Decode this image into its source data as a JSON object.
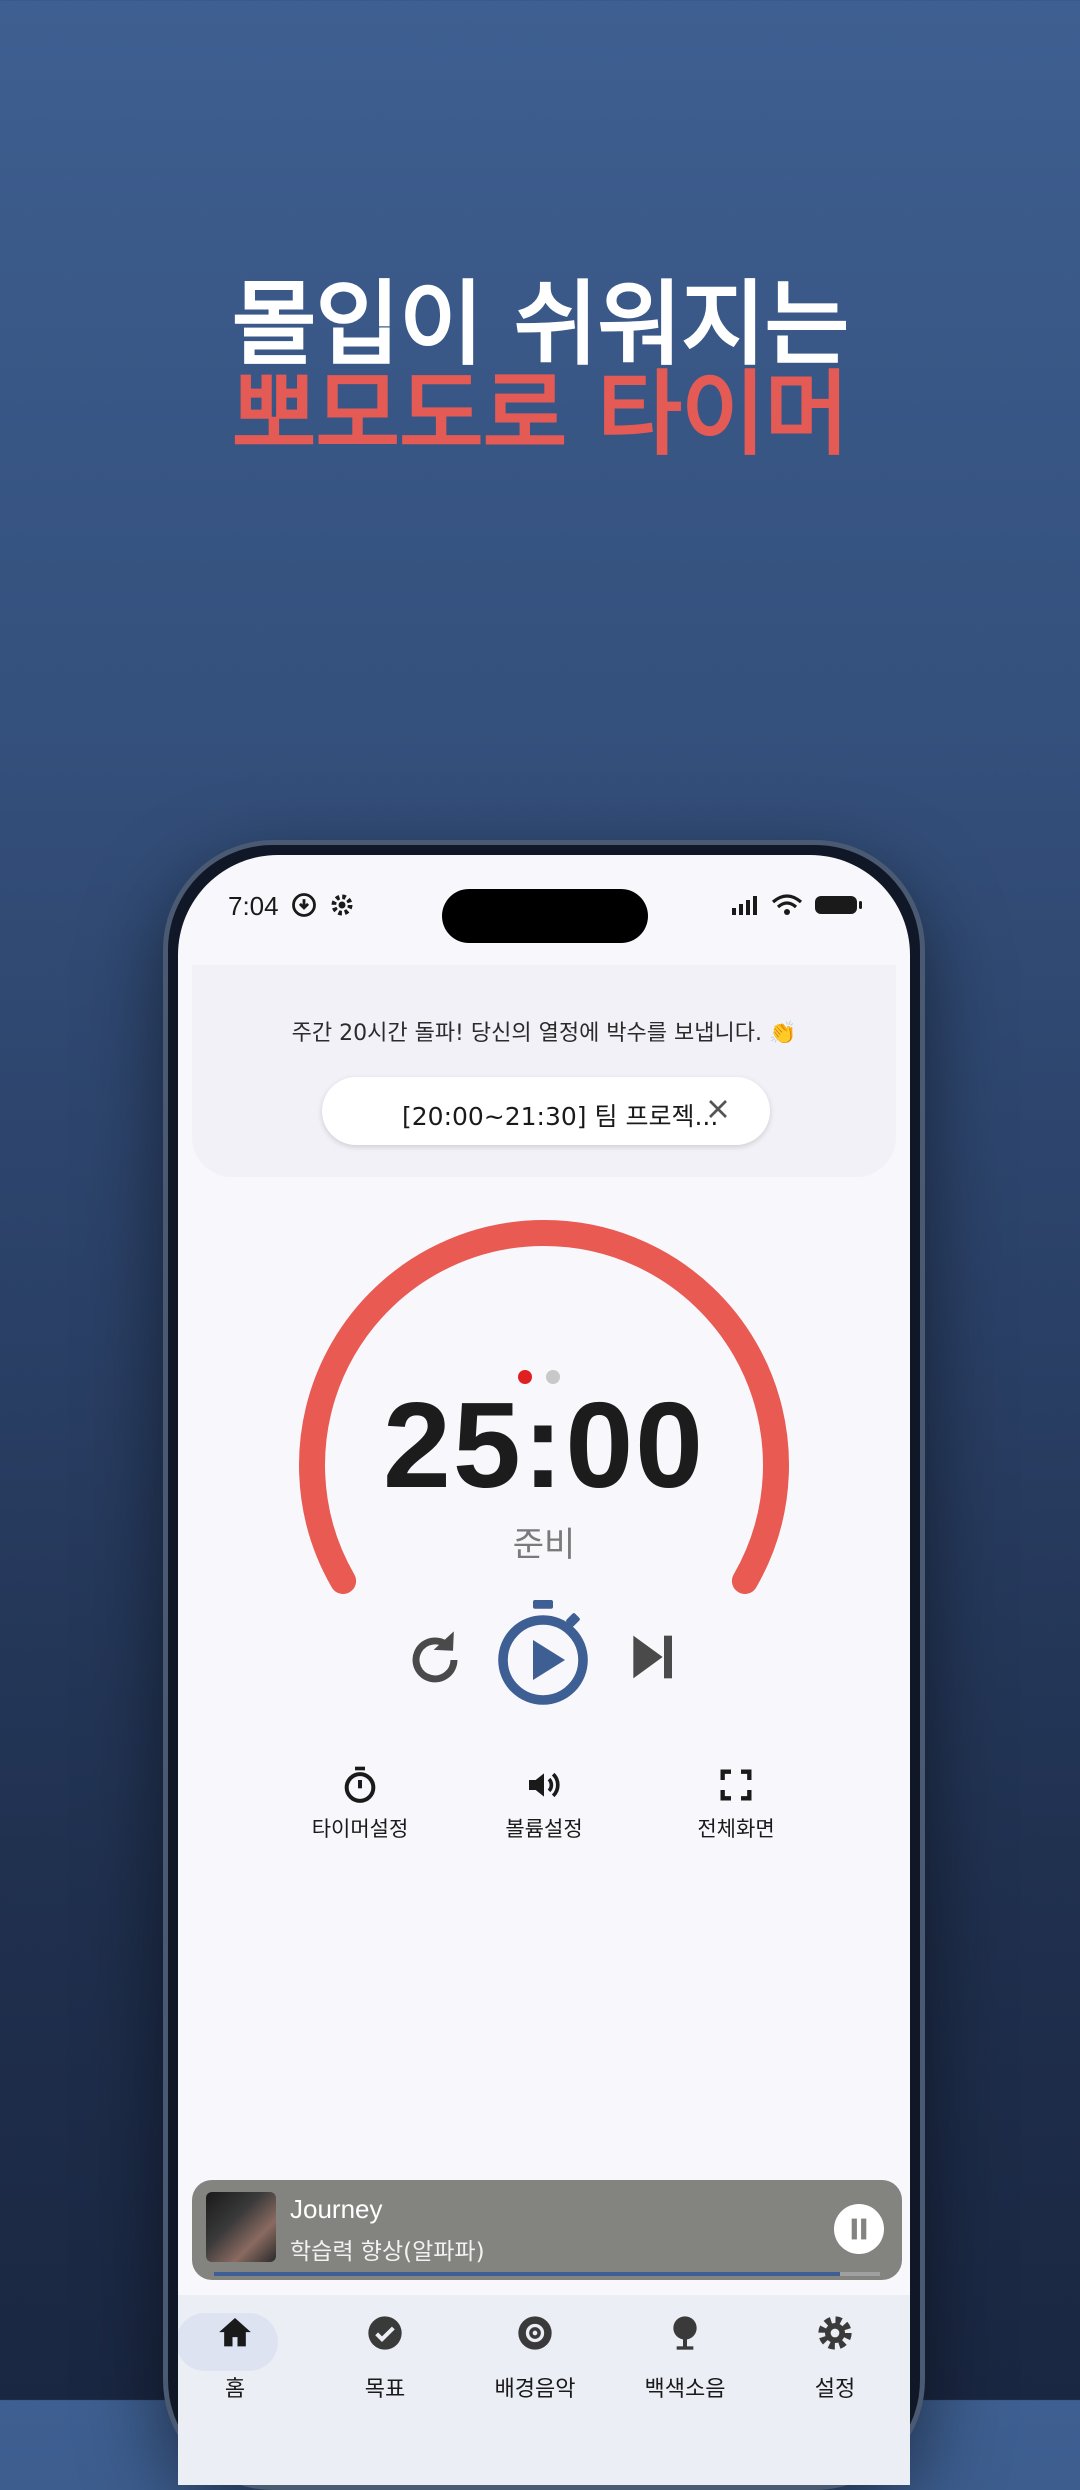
{
  "headline": {
    "line1": "몰입이 쉬워지는",
    "line2": "뽀모도로 타이머"
  },
  "status_bar": {
    "time": "7:04"
  },
  "banner": {
    "message": "주간 20시간 돌파! 당신의 열정에 박수를 보냅니다. 👏",
    "task": "[20:00~21:30] 팀 프로젝..."
  },
  "timer": {
    "time": "25:00",
    "state": "준비",
    "progress_ratio": 1.0,
    "page_dots": 2,
    "active_dot": 0
  },
  "colors": {
    "accent": "#e85a52",
    "brand_blue": "#3d5f94",
    "dot_inactive": "#c8c8c8"
  },
  "controls": {
    "reset_icon": "reset-icon",
    "play_icon": "play-timer-icon",
    "skip_icon": "skip-next-icon"
  },
  "tools": [
    {
      "label": "타이머설정",
      "icon": "timer-icon"
    },
    {
      "label": "볼륨설정",
      "icon": "volume-icon"
    },
    {
      "label": "전체화면",
      "icon": "fullscreen-icon"
    }
  ],
  "player": {
    "title": "Journey",
    "subtitle": "학습력 향상(알파파)",
    "progress": 0.94
  },
  "nav": [
    {
      "label": "홈",
      "icon": "home-icon",
      "active": true
    },
    {
      "label": "목표",
      "icon": "check-circle-icon",
      "active": false
    },
    {
      "label": "배경음악",
      "icon": "disc-icon",
      "active": false
    },
    {
      "label": "백색소음",
      "icon": "tree-icon",
      "active": false
    },
    {
      "label": "설정",
      "icon": "gear-icon",
      "active": false
    }
  ]
}
